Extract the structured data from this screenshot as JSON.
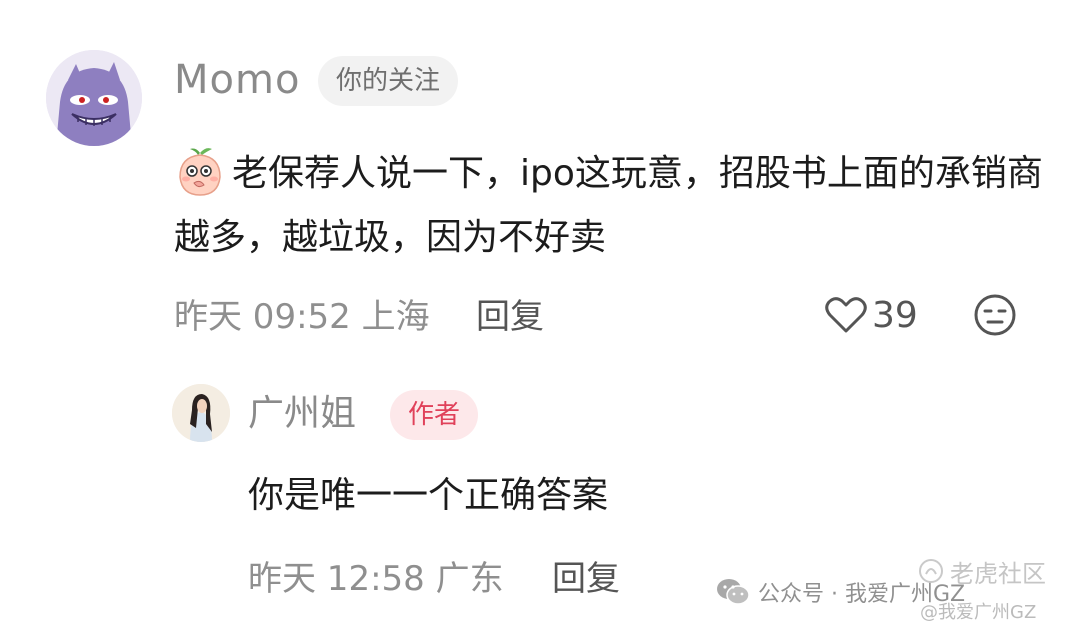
{
  "comment": {
    "username": "Momo",
    "badge": "你的关注",
    "text": "老保荐人说一下，ipo这玩意，招股书上面的承销商越多，越垃圾，因为不好卖",
    "emoji_icon": "peach-face-emoji-icon",
    "meta": "昨天 09:52 上海",
    "reply_label": "回复",
    "like_count": "39"
  },
  "reply": {
    "username": "广州姐",
    "badge": "作者",
    "text": "你是唯一一个正确答案",
    "meta": "昨天 12:58 广东",
    "reply_label": "回复"
  },
  "watermarks": {
    "wechat": "公众号 · 我爱广州GZ",
    "community": "老虎社区",
    "handle": "@我爱广州GZ"
  },
  "colors": {
    "author_badge_text": "#e0415a",
    "author_badge_bg": "#fde8ea",
    "follow_badge_bg": "#f2f2f2",
    "meta_text": "#8f8f8f"
  }
}
